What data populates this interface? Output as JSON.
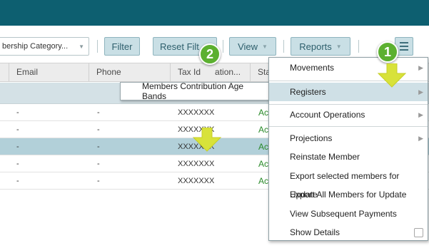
{
  "toolbar": {
    "category_select_value": "bership Category...",
    "filter_label": "Filter",
    "reset_filter_label": "Reset Filt",
    "view_label": "View",
    "reports_label": "Reports"
  },
  "table": {
    "columns": [
      "Email",
      "Phone",
      "Tax Id",
      "ation...",
      "Sta"
    ],
    "rows": [
      {
        "email": "-",
        "phone": "-",
        "tax": "XXXXXXX",
        "status": "Ac",
        "selected": false
      },
      {
        "email": "-",
        "phone": "-",
        "tax": "XXXXXXX",
        "status": "Ac",
        "selected": false
      },
      {
        "email": "-",
        "phone": "-",
        "tax": "XXXXXXX",
        "status": "Ac",
        "selected": true
      },
      {
        "email": "-",
        "phone": "-",
        "tax": "XXXXXXX",
        "status": "Ac",
        "selected": false
      },
      {
        "email": "-",
        "phone": "-",
        "tax": "XXXXXXX",
        "status": "Ac",
        "selected": false
      }
    ]
  },
  "submenu": {
    "item": "Members Contribution Age Bands"
  },
  "menu": {
    "items": [
      {
        "label": "Movements",
        "has_submenu": true
      },
      {
        "label": "Registers",
        "has_submenu": true,
        "active": true
      },
      {
        "label": "Account Operations",
        "has_submenu": true
      },
      {
        "label": "Projections",
        "has_submenu": true
      },
      {
        "label": "Reinstate Member"
      },
      {
        "label": "Export selected members for Update"
      },
      {
        "label": "Export All Members for Update"
      },
      {
        "label": "View Subsequent Payments"
      },
      {
        "label": "Show Details",
        "has_checkbox": true
      }
    ]
  },
  "callouts": {
    "one": "1",
    "two": "2",
    "badge_color": "#5cb030",
    "arrow_color": "#d8e23a"
  },
  "colors": {
    "topbar": "#0d5f70",
    "button": "#c9dfe5",
    "selected_row": "#b2d0d9",
    "status_green": "#2a8a2a"
  }
}
